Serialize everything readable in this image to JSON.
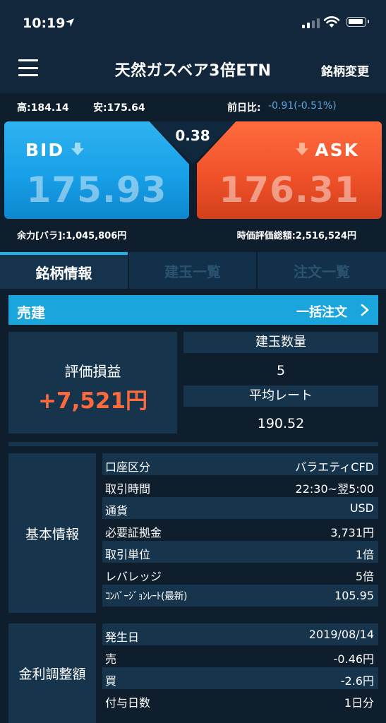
{
  "status_bar": {
    "time": "10:19"
  },
  "nav": {
    "title": "天然ガスベア3倍ETN",
    "change_label": "銘柄変更"
  },
  "stats": {
    "high": "高:184.14",
    "low": "安:175.64",
    "diff_label": "前日比:",
    "diff_value": "-0.91(-0.51%)"
  },
  "quote": {
    "bid_label": "BID",
    "ask_label": "ASK",
    "bid_price": "175.93",
    "ask_price": "176.31",
    "spread": "0.38"
  },
  "account": {
    "margin": "余力[バラ]:1,045,806円",
    "valuation": "時価評価総額:2,516,524円"
  },
  "tabs": [
    {
      "label": "銘柄情報"
    },
    {
      "label": "建玉一覧"
    },
    {
      "label": "注文一覧"
    }
  ],
  "section": {
    "title": "売建",
    "action": "一括注文"
  },
  "position": {
    "pl_label": "評価損益",
    "pl_value": "+7,521円",
    "qty_label": "建玉数量",
    "qty_value": "5",
    "rate_label": "平均レート",
    "rate_value": "190.52"
  },
  "basic_info": {
    "label": "基本情報",
    "rows": [
      {
        "key": "口座区分",
        "value": "バラエティCFD"
      },
      {
        "key": "取引時間",
        "value": "22:30~翌5:00"
      },
      {
        "key": "通貨",
        "value": "USD"
      },
      {
        "key": "必要証拠金",
        "value": "3,731円"
      },
      {
        "key": "取引単位",
        "value": "1倍"
      },
      {
        "key": "レバレッジ",
        "value": "5倍"
      },
      {
        "key": "ｺﾝﾊﾞｰｼﾞｮﾝﾚｰﾄ(最新)",
        "value": "105.95"
      }
    ]
  },
  "interest_info": {
    "label": "金利調整額",
    "rows": [
      {
        "key": "発生日",
        "value": "2019/08/14"
      },
      {
        "key": "売",
        "value": "-0.46円"
      },
      {
        "key": "買",
        "value": "-2.6円"
      },
      {
        "key": "付与日数",
        "value": "1日分"
      }
    ]
  },
  "colors": {
    "background": "#0f1e2c",
    "panel": "#17344d",
    "bid": "#18a0e8",
    "ask": "#f1522a",
    "profit": "#ff6a3d",
    "accent": "#1aa5dc",
    "diff": "#5aa7de"
  }
}
